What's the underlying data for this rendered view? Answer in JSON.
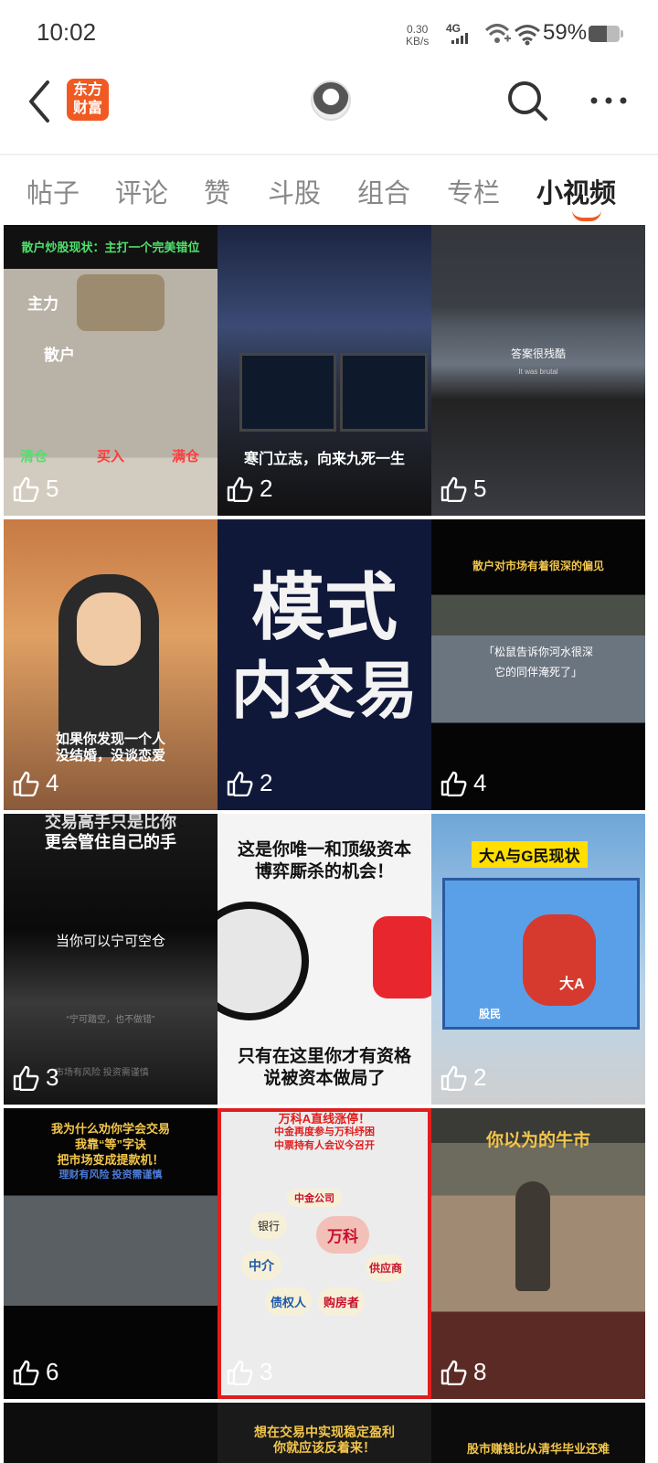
{
  "status_bar": {
    "time": "10:02",
    "net_speed_value": "0.30",
    "net_speed_unit": "KB/s",
    "network": "4G",
    "battery_text": "59%",
    "battery_level": 0.59
  },
  "header": {
    "logo_text_line1": "东方",
    "logo_text_line2": "财富",
    "icons": [
      "back-arrow-icon",
      "eagle-avatar",
      "search-icon",
      "more-icon"
    ]
  },
  "tabs": [
    {
      "label": "帖子"
    },
    {
      "label": "评论"
    },
    {
      "label": "赞"
    },
    {
      "label": "斗股"
    },
    {
      "label": "组合"
    },
    {
      "label": "专栏"
    },
    {
      "label": "小视频",
      "active": true
    }
  ],
  "videos": [
    {
      "likes": "5",
      "texts": [
        "散户炒股现状：主打一个完美错位",
        "主力",
        "散户",
        "清仓",
        "买入",
        "满仓"
      ]
    },
    {
      "likes": "2",
      "texts": [
        "寒门立志，向来九死一生"
      ]
    },
    {
      "likes": "5",
      "texts": [
        "答案很残酷",
        "It was brutal"
      ]
    },
    {
      "likes": "4",
      "texts": [
        "如果你发现一个人",
        "没结婚，没谈恋爱"
      ]
    },
    {
      "likes": "2",
      "texts": [
        "模式",
        "内交易"
      ]
    },
    {
      "likes": "4",
      "texts": [
        "散户对市场有着很深的偏见",
        "「松鼠告诉你河水很深",
        "它的同伴淹死了」"
      ]
    },
    {
      "likes": "3",
      "texts": [
        "交易高手只是比你",
        "更会管住自己的手",
        "当你可以宁可空仓",
        "“宁可踏空，也不做错”",
        "市场有风险 投资需谨慎"
      ]
    },
    {
      "likes": "",
      "texts": [
        "这是你唯一和顶级资本",
        "博弈厮杀的机会！",
        "只有在这里你才有资格",
        "说被资本做局了"
      ]
    },
    {
      "likes": "2",
      "texts": [
        "大A与G民现状",
        "大A",
        "股民"
      ]
    },
    {
      "likes": "6",
      "texts": [
        "我为什么劝你学会交易",
        "我靠“等”字诀",
        "把市场变成提款机！",
        "理财有风险 投资需谨慎"
      ]
    },
    {
      "likes": "3",
      "texts": [
        "万科A直线涨停！",
        "中金再度参与万科纾困",
        "中票持有人会议今召开",
        "中金公司",
        "银行",
        "万科",
        "中介",
        "供应商",
        "债权人",
        "购房者"
      ]
    },
    {
      "likes": "8",
      "texts": [
        "你以为的牛市"
      ]
    },
    {
      "likes": "",
      "texts": [
        ""
      ]
    },
    {
      "likes": "",
      "texts": [
        "想在交易中实现稳定盈利",
        "你就应该反着来！"
      ]
    },
    {
      "likes": "",
      "texts": [
        "股市赚钱比从清华毕业还难"
      ]
    }
  ],
  "colors": {
    "accent": "#f05a22",
    "tab_active": "#222222",
    "tab_inactive": "#888888"
  }
}
